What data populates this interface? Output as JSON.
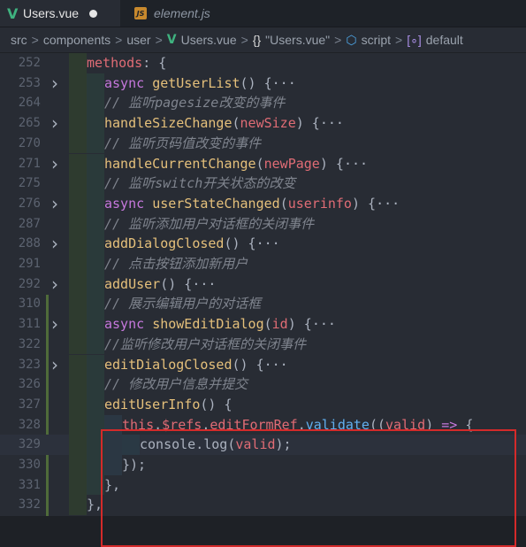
{
  "tabs": [
    {
      "label": "Users.vue",
      "icon": "vue-icon",
      "active": true,
      "modified": true
    },
    {
      "label": "element.js",
      "icon": "js-icon",
      "active": false
    }
  ],
  "breadcrumb": {
    "items": [
      "src",
      "components",
      "user",
      "Users.vue",
      "\"Users.vue\"",
      "script",
      "default"
    ]
  },
  "code_lines": [
    {
      "num": "252",
      "fold": false,
      "text": "methods: {"
    },
    {
      "num": "253",
      "fold": true,
      "text": "async getUserList() {···"
    },
    {
      "num": "264",
      "fold": false,
      "text": "// 监听pagesize改变的事件"
    },
    {
      "num": "265",
      "fold": true,
      "text": "handleSizeChange(newSize) {···"
    },
    {
      "num": "270",
      "fold": false,
      "text": "// 监听页码值改变的事件"
    },
    {
      "num": "271",
      "fold": true,
      "text": "handleCurrentChange(newPage) {···"
    },
    {
      "num": "275",
      "fold": false,
      "text": "// 监听switch开关状态的改变"
    },
    {
      "num": "276",
      "fold": true,
      "text": "async userStateChanged(userinfo) {···"
    },
    {
      "num": "287",
      "fold": false,
      "text": "// 监听添加用户对话框的关闭事件"
    },
    {
      "num": "288",
      "fold": true,
      "text": "addDialogClosed() {···"
    },
    {
      "num": "291",
      "fold": false,
      "text": "// 点击按钮添加新用户"
    },
    {
      "num": "292",
      "fold": true,
      "text": "addUser() {···"
    },
    {
      "num": "310",
      "fold": false,
      "text": "// 展示编辑用户的对话框"
    },
    {
      "num": "311",
      "fold": true,
      "text": "async showEditDialog(id) {···"
    },
    {
      "num": "322",
      "fold": false,
      "text": "//监听修改用户对话框的关闭事件"
    },
    {
      "num": "323",
      "fold": true,
      "text": "editDialogClosed() {···"
    },
    {
      "num": "326",
      "fold": false,
      "text": "// 修改用户信息并提交"
    },
    {
      "num": "327",
      "fold": false,
      "text": "editUserInfo() {"
    },
    {
      "num": "328",
      "fold": false,
      "text": "this.$refs.editFormRef.validate((valid) => {"
    },
    {
      "num": "329",
      "fold": false,
      "text": "console.log(valid);"
    },
    {
      "num": "330",
      "fold": false,
      "text": "});"
    },
    {
      "num": "331",
      "fold": false,
      "text": "},"
    },
    {
      "num": "332",
      "fold": false,
      "text": "},"
    }
  ],
  "colors": {
    "highlight_box": "#d42a2a",
    "keyword": "#c678dd",
    "function": "#e5c07b",
    "comment": "#7f848e"
  }
}
